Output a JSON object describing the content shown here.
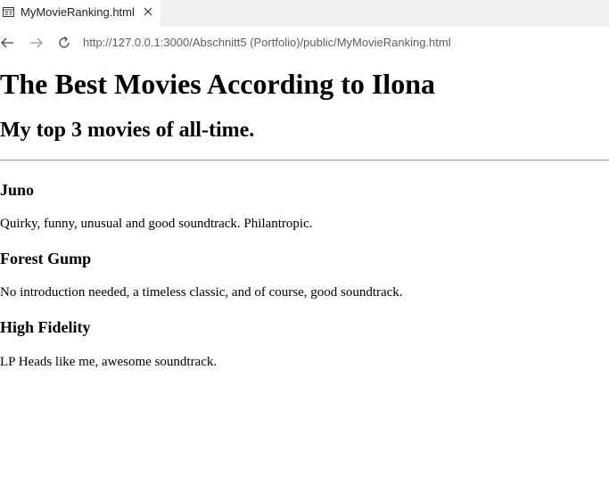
{
  "browser": {
    "tab": {
      "title": "MyMovieRanking.html",
      "favicon_icon": "page-icon",
      "close_icon": "close-icon"
    },
    "nav": {
      "back_icon": "arrow-left-icon",
      "forward_icon": "arrow-right-icon",
      "reload_icon": "reload-icon",
      "address": "http://127.0.0.1:3000/Abschnitt5 (Portfolio)/public/MyMovieRanking.html"
    }
  },
  "page": {
    "heading": "The Best Movies According to Ilona",
    "subheading": "My top 3 movies of all-time.",
    "movies": [
      {
        "title": "Juno",
        "description": "Quirky, funny, unusual and good soundtrack. Philantropic."
      },
      {
        "title": "Forest Gump",
        "description": "No introduction needed, a timeless classic, and of course, good soundtrack."
      },
      {
        "title": "High Fidelity",
        "description": "LP Heads like me, awesome soundtrack."
      }
    ]
  },
  "colors": {
    "tabstrip": "#f0f0f0",
    "address_text": "#5f5f5f",
    "rule": "#9a9a9a"
  }
}
